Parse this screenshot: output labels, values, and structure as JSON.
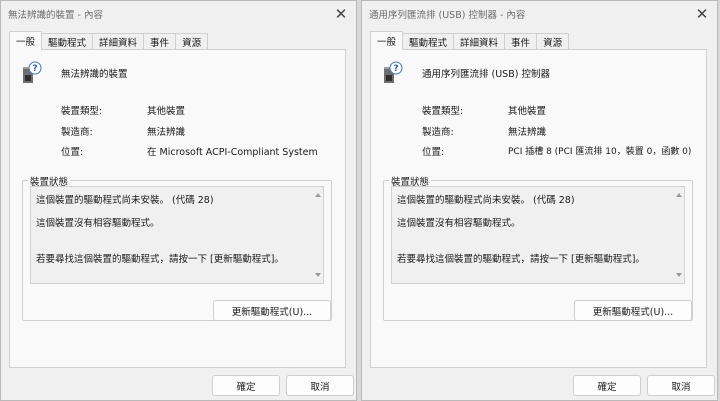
{
  "dialogs": {
    "left": {
      "title": "無法辨識的裝置 - 內容",
      "close_glyph": "✕",
      "tabs": [
        "一般",
        "驅動程式",
        "詳細資料",
        "事件",
        "資源"
      ],
      "device_name": "無法辨識的裝置",
      "props": {
        "type_label": "裝置類型:",
        "type_value": "其他裝置",
        "mfr_label": "製造商:",
        "mfr_value": "無法辨識",
        "loc_label": "位置:",
        "loc_value": "在 Microsoft ACPI-Compliant System"
      },
      "status": {
        "group_title": "裝置狀態",
        "line1": "這個裝置的驅動程式尚未安裝。 (代碼 28)",
        "line2": "這個裝置沒有相容驅動程式。",
        "line3": "若要尋找這個裝置的驅動程式，請按一下 [更新驅動程式]。"
      },
      "update_button": "更新驅動程式(U)...",
      "ok_button": "確定",
      "cancel_button": "取消"
    },
    "right": {
      "title": "通用序列匯流排 (USB) 控制器 - 內容",
      "close_glyph": "✕",
      "tabs": [
        "一般",
        "驅動程式",
        "詳細資料",
        "事件",
        "資源"
      ],
      "device_name": "通用序列匯流排 (USB) 控制器",
      "props": {
        "type_label": "裝置類型:",
        "type_value": "其他裝置",
        "mfr_label": "製造商:",
        "mfr_value": "無法辨識",
        "loc_label": "位置:",
        "loc_value": "PCI 插槽 8 (PCI 匯流排 10，裝置 0，函數 0)"
      },
      "status": {
        "group_title": "裝置狀態",
        "line1": "這個裝置的驅動程式尚未安裝。 (代碼 28)",
        "line2": "這個裝置沒有相容驅動程式。",
        "line3": "若要尋找這個裝置的驅動程式，請按一下 [更新驅動程式]。"
      },
      "update_button": "更新驅動程式(U)...",
      "ok_button": "確定",
      "cancel_button": "取消"
    }
  },
  "icons": {
    "device": "unknown-device-icon",
    "close": "close-icon"
  },
  "colors": {
    "dialog_bg": "#f0f0f0",
    "panel_bg": "#f9f9f9",
    "border": "#d0d0d0"
  }
}
